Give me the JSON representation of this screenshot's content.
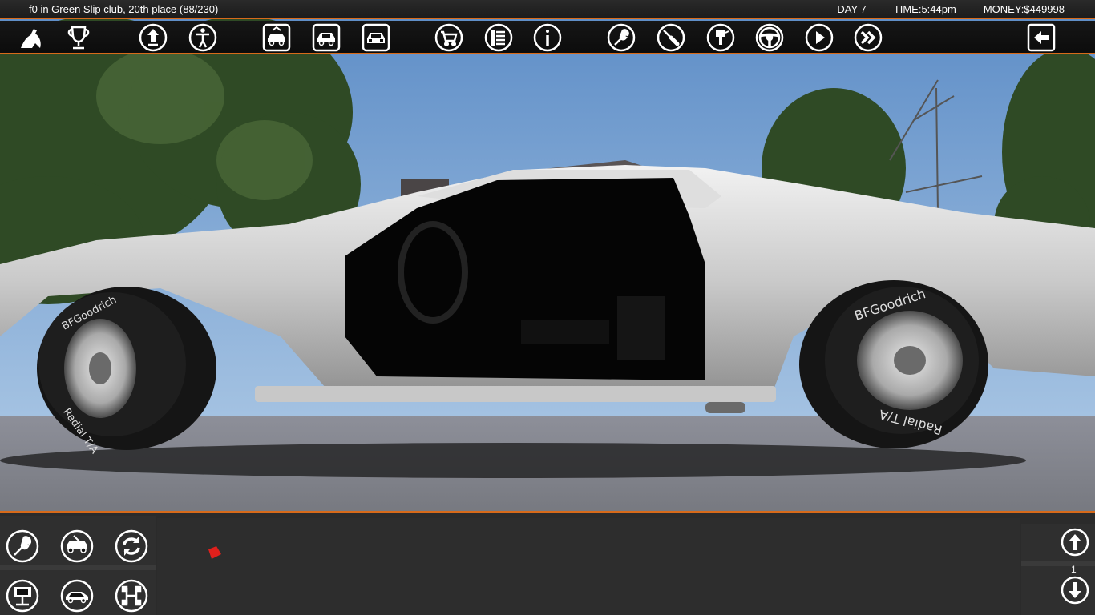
{
  "status": {
    "club_info": "f0 in Green Slip club, 20th place (88/230)",
    "day": "DAY 7",
    "time": "TIME:5:44pm",
    "money": "MONEY:$449998"
  },
  "toolbar": {
    "buttons": [
      {
        "icon": "bird-logo-icon"
      },
      {
        "icon": "trophy-icon"
      },
      {
        "icon": "upgrade-arrow-icon"
      },
      {
        "icon": "driver-person-icon"
      },
      {
        "icon": "car-garage-1-icon"
      },
      {
        "icon": "car-garage-2-icon"
      },
      {
        "icon": "car-garage-3-icon"
      },
      {
        "icon": "shopping-cart-icon"
      },
      {
        "icon": "list-icon"
      },
      {
        "icon": "info-icon"
      },
      {
        "icon": "wrench-icon"
      },
      {
        "icon": "screwdriver-icon"
      },
      {
        "icon": "paint-spray-icon"
      },
      {
        "icon": "steering-wheel-icon"
      },
      {
        "icon": "play-icon"
      },
      {
        "icon": "fast-forward-icon"
      },
      {
        "icon": "back-arrow-icon"
      }
    ]
  },
  "bottom": {
    "left_tools": [
      {
        "icon": "wrench-tool-icon"
      },
      {
        "icon": "car-repair-icon"
      },
      {
        "icon": "refresh-cycle-icon"
      },
      {
        "icon": "engine-stand-icon"
      },
      {
        "icon": "car-body-icon"
      },
      {
        "icon": "chassis-frame-icon"
      }
    ],
    "page_number": "1"
  },
  "colors": {
    "accent": "#d76a1a",
    "sky": "#6f9ccf",
    "bar_bg": "#121212",
    "panel_bg": "#2b2b2b"
  }
}
